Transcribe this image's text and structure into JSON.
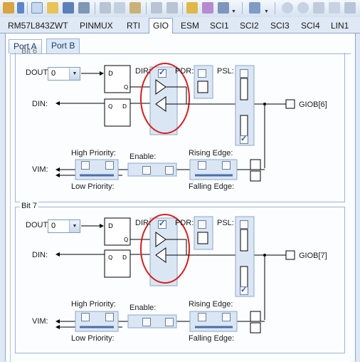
{
  "toolbar": {
    "icons": [
      "cut-icon",
      "copy-icon",
      "paste-icon",
      "undo-icon",
      "redo-icon",
      "find-icon",
      "checklist-icon",
      "settings-icon",
      "stack-icon",
      "back-icon",
      "forward-icon",
      "edit-icon",
      "home-icon",
      "tool-icon",
      "search-icon"
    ]
  },
  "tabs": [
    "RM57L843ZWT",
    "PINMUX",
    "RTI",
    "GIO",
    "ESM",
    "SCI1",
    "SCI2",
    "SCI3",
    "SCI4",
    "LIN1"
  ],
  "active_tab": "GIO",
  "port_tabs": [
    "Port A",
    "Port B"
  ],
  "active_port_tab": "Port B",
  "bit6": {
    "title": "Bit 6",
    "dout_label": "DOUT:",
    "dout_value": "0",
    "din_label": "DIN:",
    "dir_label": "DIR:",
    "pdr_label": "PDR:",
    "psl_label": "PSL:",
    "pin_label": "GIOB[6]",
    "vim_label": "VIM:",
    "high_priority": "High Priority:",
    "low_priority": "Low Priority:",
    "enable": "Enable:",
    "rising_edge": "Rising Edge:",
    "falling_edge": "Falling Edge:",
    "dir_checked": true,
    "psl_low_checked": true
  },
  "bit7": {
    "title": "Bit 7",
    "dout_label": "DOUT:",
    "dout_value": "0",
    "din_label": "DIN:",
    "dir_label": "DIR:",
    "pdr_label": "PDR:",
    "psl_label": "PSL:",
    "pin_label": "GIOB[7]",
    "vim_label": "VIM:",
    "high_priority": "High Priority:",
    "low_priority": "Low Priority:",
    "enable": "Enable:",
    "rising_edge": "Rising Edge:",
    "falling_edge": "Falling Edge:",
    "dir_checked": true,
    "psl_low_checked": true
  },
  "colors": {
    "highlight_circle": "#d42020",
    "wire": "#000000",
    "block_fill": "#dbe6f4"
  }
}
